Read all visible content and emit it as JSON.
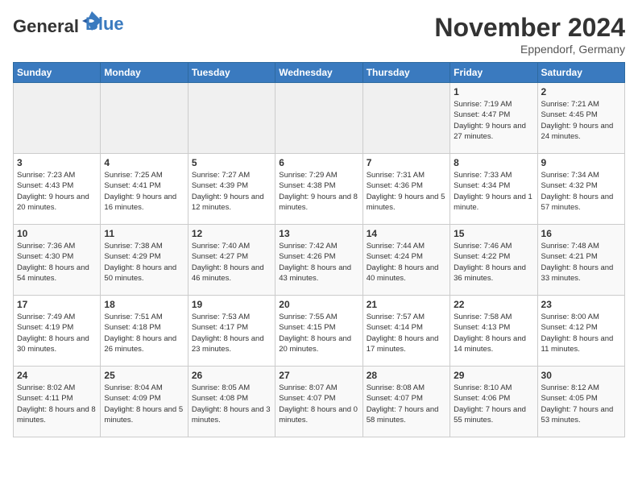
{
  "header": {
    "logo_line1": "General",
    "logo_line2": "Blue",
    "month_title": "November 2024",
    "location": "Eppendorf, Germany"
  },
  "days_of_week": [
    "Sunday",
    "Monday",
    "Tuesday",
    "Wednesday",
    "Thursday",
    "Friday",
    "Saturday"
  ],
  "weeks": [
    [
      {
        "day": "",
        "info": ""
      },
      {
        "day": "",
        "info": ""
      },
      {
        "day": "",
        "info": ""
      },
      {
        "day": "",
        "info": ""
      },
      {
        "day": "",
        "info": ""
      },
      {
        "day": "1",
        "info": "Sunrise: 7:19 AM\nSunset: 4:47 PM\nDaylight: 9 hours and 27 minutes."
      },
      {
        "day": "2",
        "info": "Sunrise: 7:21 AM\nSunset: 4:45 PM\nDaylight: 9 hours and 24 minutes."
      }
    ],
    [
      {
        "day": "3",
        "info": "Sunrise: 7:23 AM\nSunset: 4:43 PM\nDaylight: 9 hours and 20 minutes."
      },
      {
        "day": "4",
        "info": "Sunrise: 7:25 AM\nSunset: 4:41 PM\nDaylight: 9 hours and 16 minutes."
      },
      {
        "day": "5",
        "info": "Sunrise: 7:27 AM\nSunset: 4:39 PM\nDaylight: 9 hours and 12 minutes."
      },
      {
        "day": "6",
        "info": "Sunrise: 7:29 AM\nSunset: 4:38 PM\nDaylight: 9 hours and 8 minutes."
      },
      {
        "day": "7",
        "info": "Sunrise: 7:31 AM\nSunset: 4:36 PM\nDaylight: 9 hours and 5 minutes."
      },
      {
        "day": "8",
        "info": "Sunrise: 7:33 AM\nSunset: 4:34 PM\nDaylight: 9 hours and 1 minute."
      },
      {
        "day": "9",
        "info": "Sunrise: 7:34 AM\nSunset: 4:32 PM\nDaylight: 8 hours and 57 minutes."
      }
    ],
    [
      {
        "day": "10",
        "info": "Sunrise: 7:36 AM\nSunset: 4:30 PM\nDaylight: 8 hours and 54 minutes."
      },
      {
        "day": "11",
        "info": "Sunrise: 7:38 AM\nSunset: 4:29 PM\nDaylight: 8 hours and 50 minutes."
      },
      {
        "day": "12",
        "info": "Sunrise: 7:40 AM\nSunset: 4:27 PM\nDaylight: 8 hours and 46 minutes."
      },
      {
        "day": "13",
        "info": "Sunrise: 7:42 AM\nSunset: 4:26 PM\nDaylight: 8 hours and 43 minutes."
      },
      {
        "day": "14",
        "info": "Sunrise: 7:44 AM\nSunset: 4:24 PM\nDaylight: 8 hours and 40 minutes."
      },
      {
        "day": "15",
        "info": "Sunrise: 7:46 AM\nSunset: 4:22 PM\nDaylight: 8 hours and 36 minutes."
      },
      {
        "day": "16",
        "info": "Sunrise: 7:48 AM\nSunset: 4:21 PM\nDaylight: 8 hours and 33 minutes."
      }
    ],
    [
      {
        "day": "17",
        "info": "Sunrise: 7:49 AM\nSunset: 4:19 PM\nDaylight: 8 hours and 30 minutes."
      },
      {
        "day": "18",
        "info": "Sunrise: 7:51 AM\nSunset: 4:18 PM\nDaylight: 8 hours and 26 minutes."
      },
      {
        "day": "19",
        "info": "Sunrise: 7:53 AM\nSunset: 4:17 PM\nDaylight: 8 hours and 23 minutes."
      },
      {
        "day": "20",
        "info": "Sunrise: 7:55 AM\nSunset: 4:15 PM\nDaylight: 8 hours and 20 minutes."
      },
      {
        "day": "21",
        "info": "Sunrise: 7:57 AM\nSunset: 4:14 PM\nDaylight: 8 hours and 17 minutes."
      },
      {
        "day": "22",
        "info": "Sunrise: 7:58 AM\nSunset: 4:13 PM\nDaylight: 8 hours and 14 minutes."
      },
      {
        "day": "23",
        "info": "Sunrise: 8:00 AM\nSunset: 4:12 PM\nDaylight: 8 hours and 11 minutes."
      }
    ],
    [
      {
        "day": "24",
        "info": "Sunrise: 8:02 AM\nSunset: 4:11 PM\nDaylight: 8 hours and 8 minutes."
      },
      {
        "day": "25",
        "info": "Sunrise: 8:04 AM\nSunset: 4:09 PM\nDaylight: 8 hours and 5 minutes."
      },
      {
        "day": "26",
        "info": "Sunrise: 8:05 AM\nSunset: 4:08 PM\nDaylight: 8 hours and 3 minutes."
      },
      {
        "day": "27",
        "info": "Sunrise: 8:07 AM\nSunset: 4:07 PM\nDaylight: 8 hours and 0 minutes."
      },
      {
        "day": "28",
        "info": "Sunrise: 8:08 AM\nSunset: 4:07 PM\nDaylight: 7 hours and 58 minutes."
      },
      {
        "day": "29",
        "info": "Sunrise: 8:10 AM\nSunset: 4:06 PM\nDaylight: 7 hours and 55 minutes."
      },
      {
        "day": "30",
        "info": "Sunrise: 8:12 AM\nSunset: 4:05 PM\nDaylight: 7 hours and 53 minutes."
      }
    ]
  ]
}
